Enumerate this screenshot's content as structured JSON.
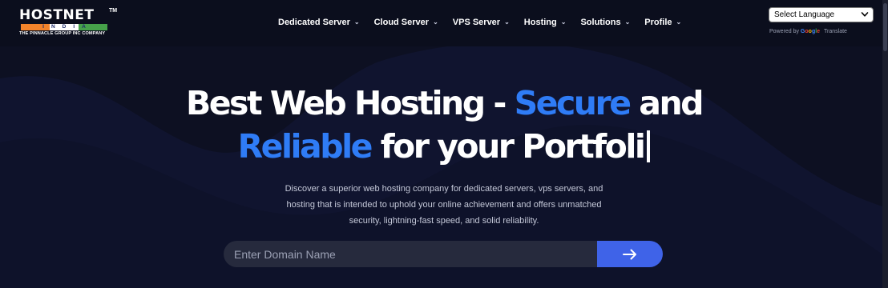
{
  "header": {
    "logo": {
      "name": "HOSTNET",
      "tm": "TM",
      "flag_text": "INDIA",
      "subtitle": "THE PINNACLE GROUP INC COMPANY"
    },
    "nav": [
      {
        "label": "Dedicated Server"
      },
      {
        "label": "Cloud Server"
      },
      {
        "label": "VPS Server"
      },
      {
        "label": "Hosting"
      },
      {
        "label": "Solutions"
      },
      {
        "label": "Profile"
      }
    ],
    "language": {
      "selected": "Select Language",
      "powered_by": "Powered by",
      "google": [
        "G",
        "o",
        "o",
        "g",
        "l",
        "e"
      ],
      "translate": "Translate"
    }
  },
  "hero": {
    "title_part1": "Best Web Hosting - ",
    "title_accent1": "Secure",
    "title_part2": " and",
    "title_accent2": "Reliable",
    "title_part3": " for your Portfoli",
    "description": "Discover a superior web hosting company for dedicated servers, vps servers, and hosting that is intended to uphold your online achievement and offers unmatched security, lightning-fast speed, and solid reliability.",
    "search": {
      "placeholder": "Enter Domain Name",
      "button_icon": "arrow-right-icon"
    }
  },
  "colors": {
    "background": "#0d1022",
    "accent": "#2f7cf6",
    "button": "#3f63e8",
    "input": "#262a3d"
  }
}
